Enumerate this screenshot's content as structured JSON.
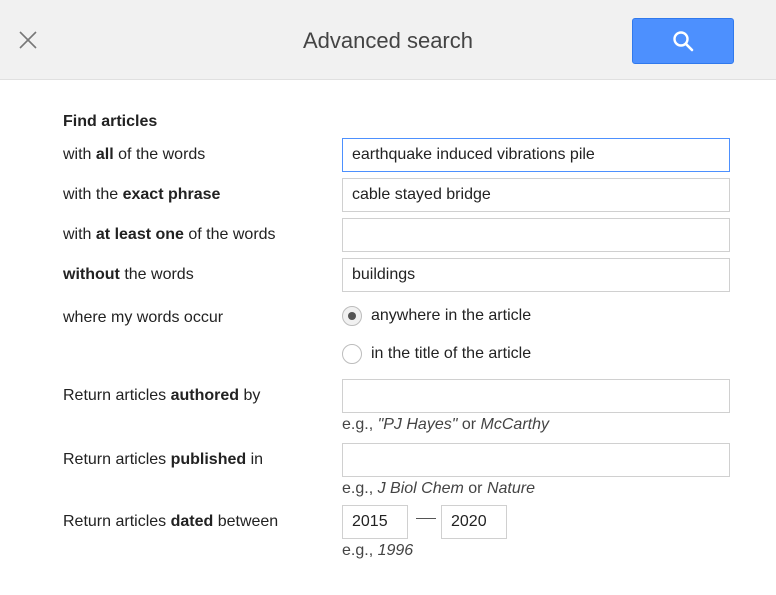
{
  "header": {
    "title": "Advanced search",
    "close_icon": "close-icon",
    "search_icon": "search-icon",
    "accent": "#4d90fe"
  },
  "find": {
    "heading": "Find articles",
    "all_words": {
      "label_pre": "with ",
      "label_bold": "all",
      "label_post": " of the words",
      "value": "earthquake induced vibrations pile"
    },
    "exact_phrase": {
      "label_pre": "with the ",
      "label_bold": "exact phrase",
      "label_post": "",
      "value": "cable stayed bridge"
    },
    "at_least_one": {
      "label_pre": "with ",
      "label_bold": "at least one",
      "label_post": " of the words",
      "value": ""
    },
    "without": {
      "label_pre": "",
      "label_bold": "without",
      "label_post": " the words",
      "value": "buildings"
    },
    "occur": {
      "label": "where my words occur",
      "options": [
        {
          "label": "anywhere in the article",
          "checked": true
        },
        {
          "label": "in the title of the article",
          "checked": false
        }
      ]
    },
    "authored": {
      "label_pre": "Return articles ",
      "label_bold": "authored",
      "label_post": " by",
      "value": "",
      "hint_pre": "e.g., ",
      "hint_ex1": "\"PJ Hayes\"",
      "hint_mid": " or ",
      "hint_ex2": "McCarthy"
    },
    "published": {
      "label_pre": "Return articles ",
      "label_bold": "published",
      "label_post": " in",
      "value": "",
      "hint_pre": "e.g., ",
      "hint_ex1": "J Biol Chem",
      "hint_mid": " or ",
      "hint_ex2": "Nature"
    },
    "dated": {
      "label_pre": "Return articles ",
      "label_bold": "dated",
      "label_post": " between",
      "from": "2015",
      "to": "2020",
      "hint_pre": "e.g., ",
      "hint_ex": "1996"
    }
  }
}
